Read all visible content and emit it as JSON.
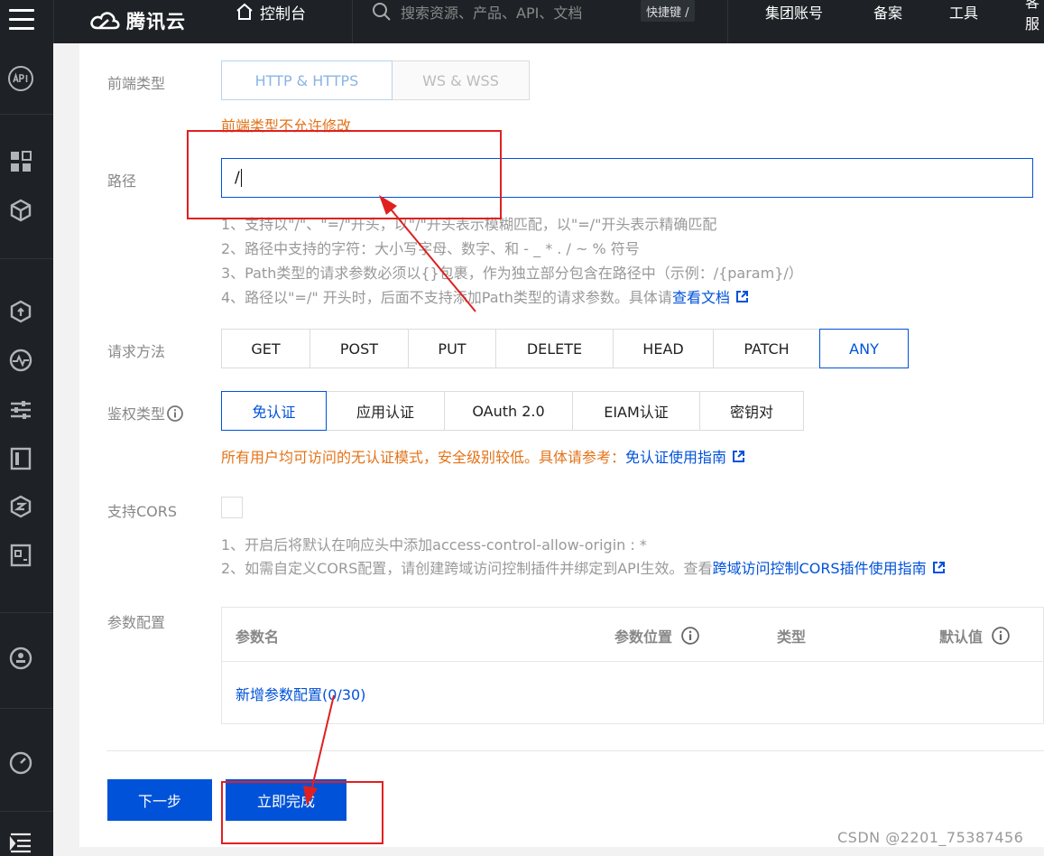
{
  "header": {
    "logo_text": "腾讯云",
    "console": "控制台",
    "search_placeholder": "搜索资源、产品、API、文档",
    "shortcut": "快捷键 /",
    "nav": [
      "集团账号",
      "备案",
      "工具",
      "客服"
    ]
  },
  "form": {
    "frontend_type": {
      "label": "前端类型",
      "options": [
        "HTTP & HTTPS",
        "WS & WSS"
      ],
      "selected": "HTTP & HTTPS",
      "warning": "前端类型不允许修改"
    },
    "path": {
      "label": "路径",
      "value": "/",
      "hints": [
        "1、支持以\"/\"、\"=/\"开头，以\"/\"开头表示模糊匹配，以\"=/\"开头表示精确匹配",
        "2、路径中支持的字符：大小写字母、数字、和 - _ * . / ~ % 符号",
        "3、Path类型的请求参数必须以{}包裹，作为独立部分包含在路径中（示例：/{param}/）",
        "4、路径以\"=/\" 开头时，后面不支持添加Path类型的请求参数。具体请"
      ],
      "doc_link": "查看文档"
    },
    "method": {
      "label": "请求方法",
      "options": [
        "GET",
        "POST",
        "PUT",
        "DELETE",
        "HEAD",
        "PATCH",
        "ANY"
      ],
      "selected": "ANY"
    },
    "auth": {
      "label": "鉴权类型",
      "options": [
        "免认证",
        "应用认证",
        "OAuth 2.0",
        "EIAM认证",
        "密钥对"
      ],
      "selected": "免认证",
      "warning": "所有用户均可访问的无认证模式，安全级别较低。具体请参考：",
      "guide_link": "免认证使用指南"
    },
    "cors": {
      "label": "支持CORS",
      "checked": false,
      "hints": [
        "1、开启后将默认在响应头中添加access-control-allow-origin : *",
        "2、如需自定义CORS配置，请创建跨域访问控制插件并绑定到API生效。查看"
      ],
      "guide_link": "跨域访问控制CORS插件使用指南"
    },
    "params": {
      "label": "参数配置",
      "columns": [
        "参数名",
        "参数位置",
        "类型",
        "默认值"
      ],
      "add_link": "新增参数配置(0/30)"
    }
  },
  "buttons": {
    "next": "下一步",
    "finish": "立即完成"
  },
  "watermark": "CSDN @2201_75387456",
  "colors": {
    "primary": "#0052d9",
    "warning": "#e37318",
    "annotation": "#e02020",
    "topbar": "#1e2226"
  }
}
